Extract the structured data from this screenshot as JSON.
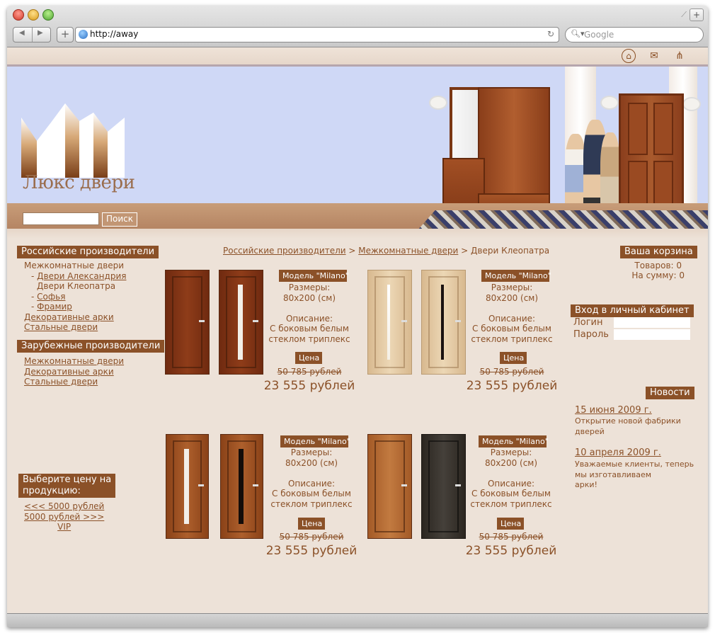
{
  "browser": {
    "url": "http://away",
    "search_placeholder": "Google",
    "icons": [
      "back-icon",
      "forward-icon",
      "add-bookmark-icon",
      "globe-icon",
      "reload-icon",
      "search-icon"
    ]
  },
  "header": {
    "logo_text": "Люкс двери",
    "search_button": "Поиск",
    "search_value": "",
    "top_icons": [
      "home-icon",
      "mail-icon",
      "sitemap-icon"
    ]
  },
  "sidebar": {
    "russian_title": "Российские производители",
    "russian_items": [
      {
        "label": "Межкомнатные двери",
        "link": false
      },
      {
        "label": "Двери Александрия",
        "link": true,
        "prefix": "- "
      },
      {
        "label": "Двери Клеопатра",
        "link": false
      },
      {
        "label": "Софья",
        "link": true,
        "prefix": "- "
      },
      {
        "label": "Фрамир",
        "link": true,
        "prefix": "- "
      },
      {
        "label": "Декоративные арки",
        "link": true
      },
      {
        "label": "Стальные двери",
        "link": true
      }
    ],
    "foreign_title": "Зарубежные производители",
    "foreign_items": [
      {
        "label": "Межкомнатные двери",
        "link": true
      },
      {
        "label": "Декоративные арки",
        "link": true
      },
      {
        "label": "Стальные двери",
        "link": true
      }
    ],
    "price_title_1": "Выберите цену на",
    "price_title_2": "продукцию:",
    "price_items": [
      "<<< 5000 рублей",
      "5000 рублей >>>",
      "VIP"
    ]
  },
  "breadcrumb": {
    "item1": "Российские производители",
    "sep1": " > ",
    "item2": "Межкомнатные двери",
    "sep2": " > ",
    "current": "Двери Клеопатра"
  },
  "products": [
    {
      "model": "Модель \"Milano\"",
      "size_label": "Размеры:",
      "size": "80x200 (см)",
      "desc_label": "Описание:",
      "desc_1": "С боковым белым",
      "desc_2": "стеклом триплекс",
      "price_label": "Цена",
      "old_price": "50 785 рублей",
      "new_price": "23 555 рублей"
    },
    {
      "model": "Модель \"Milano\"",
      "size_label": "Размеры:",
      "size": "80x200 (см)",
      "desc_label": "Описание:",
      "desc_1": "С боковым белым",
      "desc_2": "стеклом триплекс",
      "price_label": "Цена",
      "old_price": "50 785 рублей",
      "new_price": "23 555 рублей"
    },
    {
      "model": "Модель \"Milano\"",
      "size_label": "Размеры:",
      "size": "80x200 (см)",
      "desc_label": "Описание:",
      "desc_1": "С боковым белым",
      "desc_2": "стеклом триплекс",
      "price_label": "Цена",
      "old_price": "50 785 рублей",
      "new_price": "23 555 рублей"
    },
    {
      "model": "Модель \"Milano\"",
      "size_label": "Размеры:",
      "size": "80x200 (см)",
      "desc_label": "Описание:",
      "desc_1": "С боковым белым",
      "desc_2": "стеклом триплекс",
      "price_label": "Цена",
      "old_price": "50 785 рублей",
      "new_price": "23 555 рублей"
    }
  ],
  "cart": {
    "title": "Ваша корзина",
    "items": "Товаров: 0",
    "sum": "На сумму: 0"
  },
  "login": {
    "title": "Вход  в личный кабинет",
    "login_label": "Логин",
    "password_label": "Пароль",
    "login_value": "",
    "password_value": ""
  },
  "news": {
    "title": "Новости",
    "items": [
      {
        "date": "15 июня 2009 г.",
        "text_1": "Открытие новой фабрики",
        "text_2": "дверей",
        "text_3": ""
      },
      {
        "date": "10 апреля 2009 г.",
        "text_1": "Уважаемые клиенты, теперь",
        "text_2": "мы изготавливаем",
        "text_3": "арки!"
      }
    ]
  },
  "colors": {
    "accent_brown": "#8b5128",
    "page_bg": "#ede2d8",
    "header_sky": "#cfd8f6"
  }
}
